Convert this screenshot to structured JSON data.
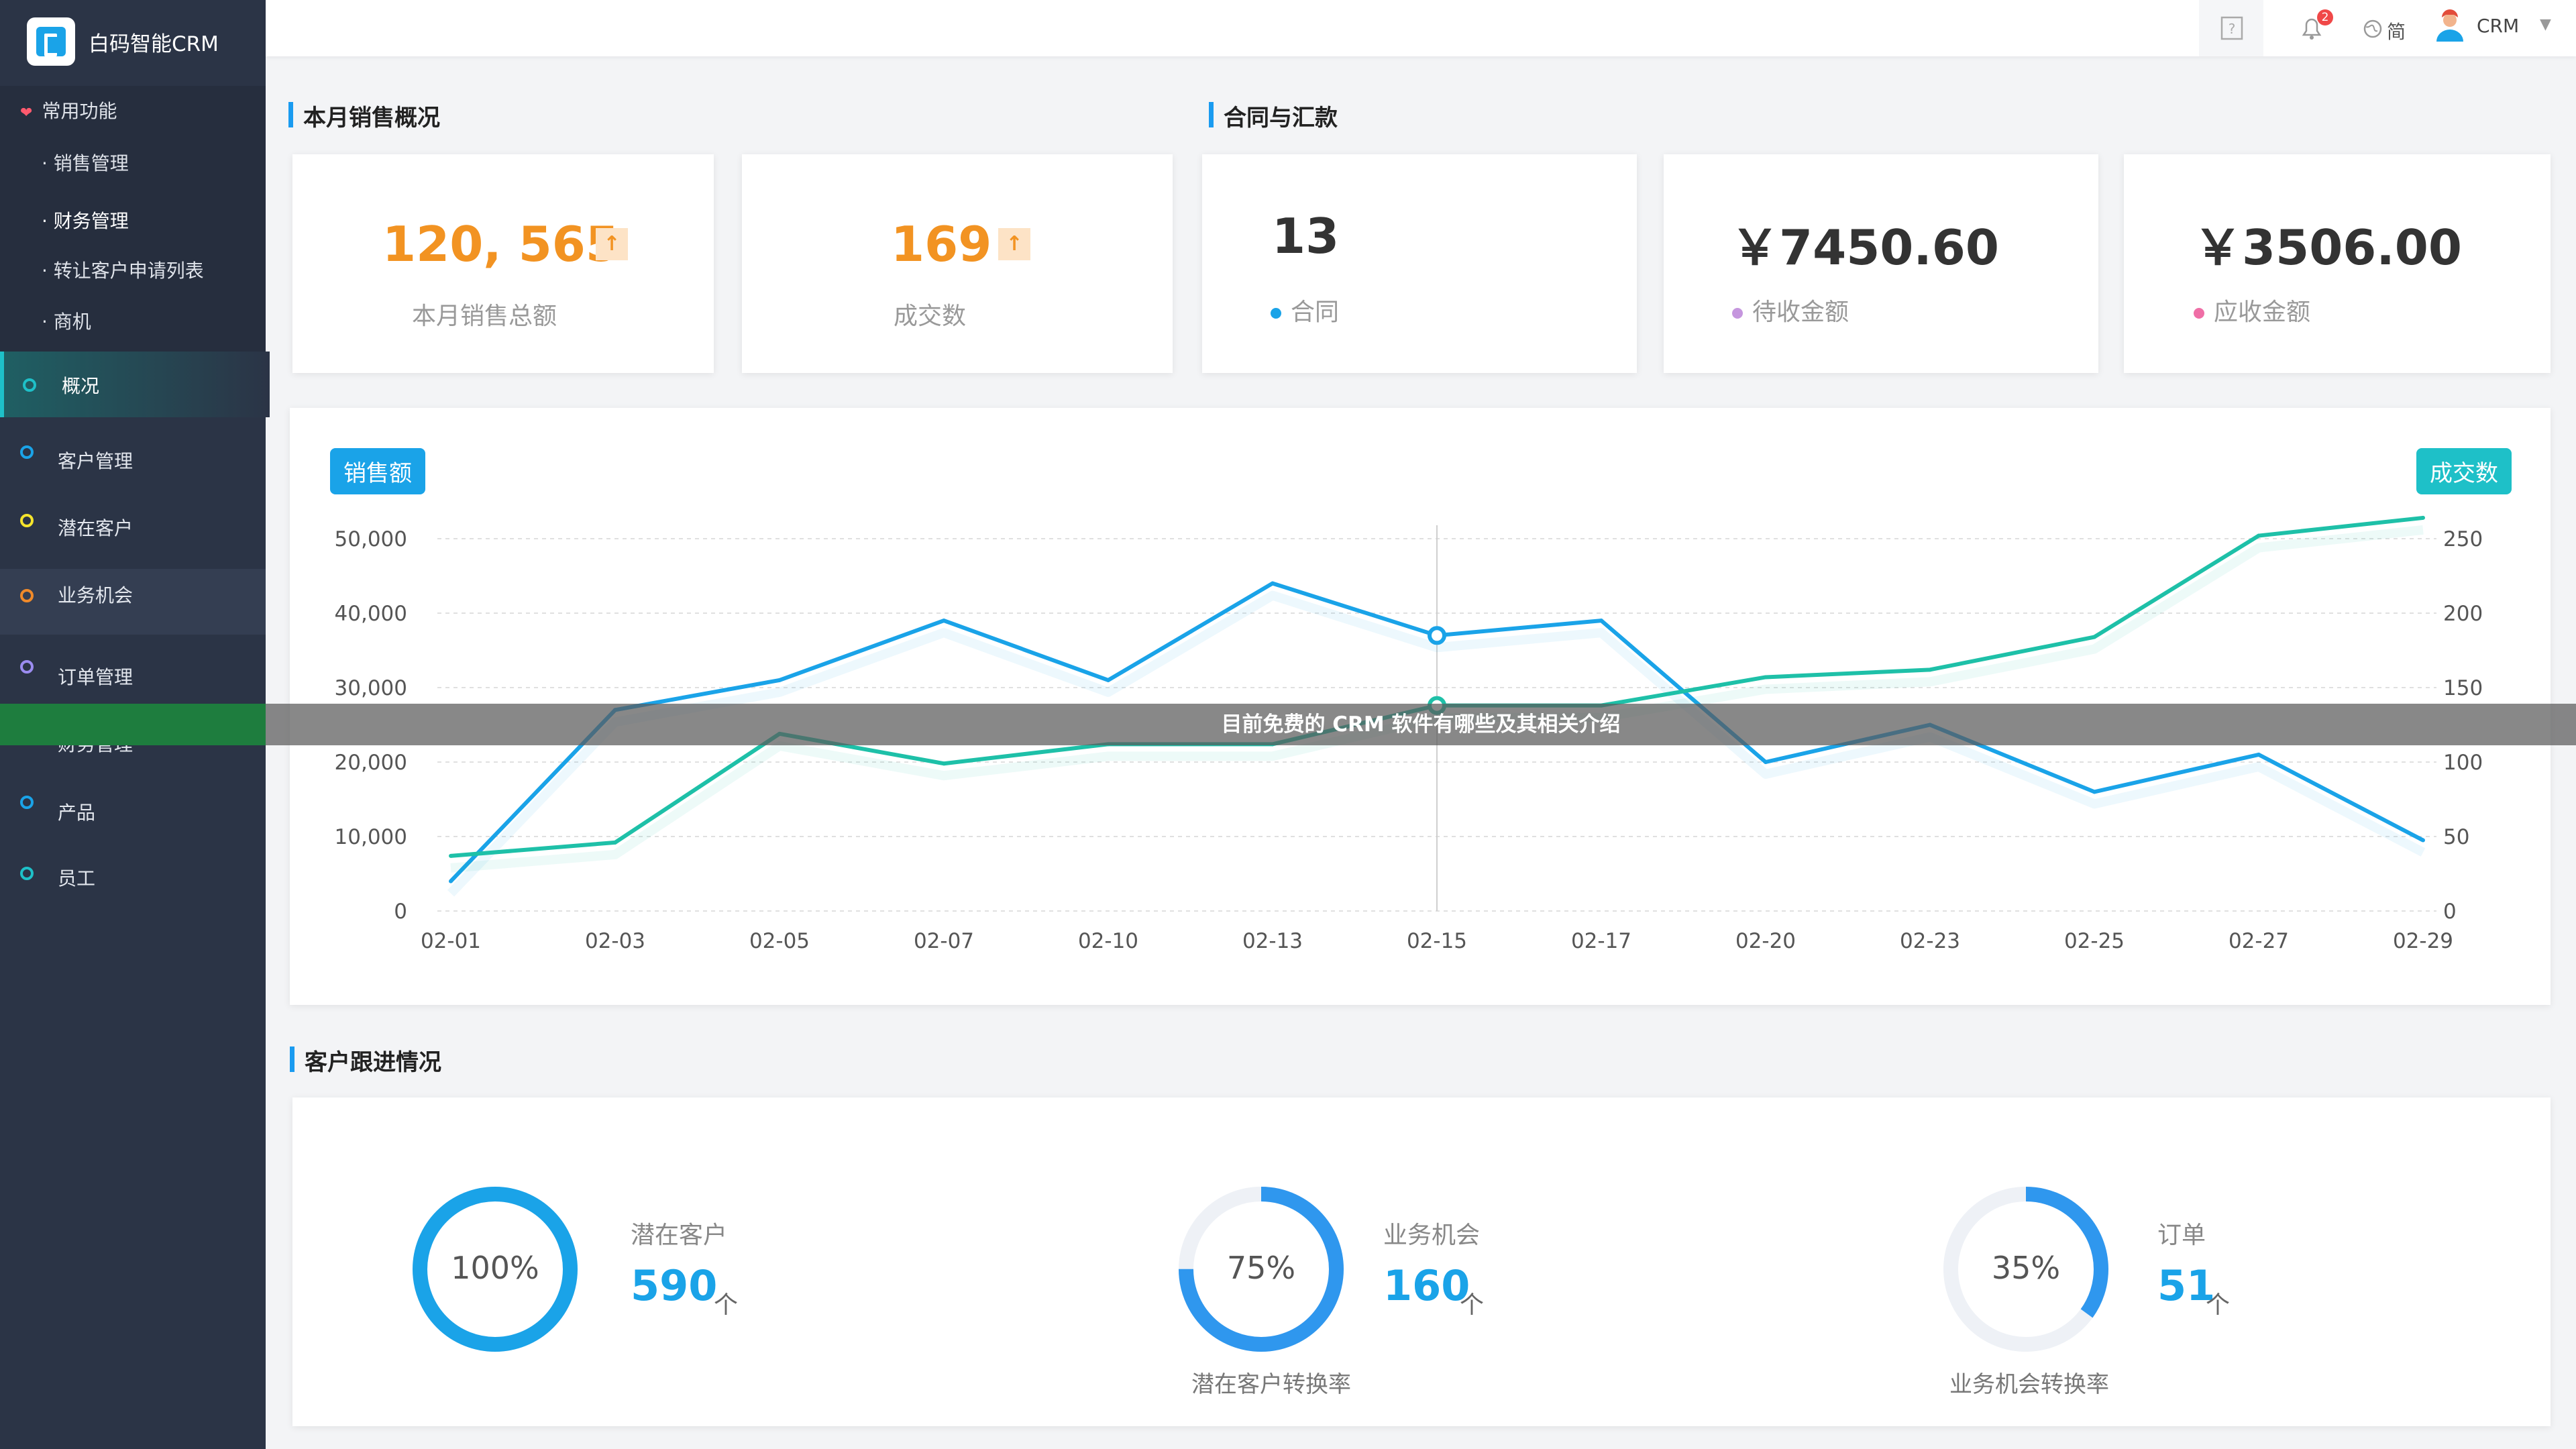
{
  "app": {
    "name": "白码智能CRM"
  },
  "sidebar": {
    "section_title": "常用功能",
    "sub_items": [
      {
        "label": "· 销售管理"
      },
      {
        "label": "· 财务管理"
      },
      {
        "label": "· 转让客户申请列表"
      },
      {
        "label": "· 商机"
      }
    ],
    "nav_items": [
      {
        "label": "概况",
        "color": "#1ec0c8"
      },
      {
        "label": "客户管理",
        "color": "#1aa3e8"
      },
      {
        "label": "潜在客户",
        "color": "#f5e42c"
      },
      {
        "label": "业务机会",
        "color": "#f08a2a"
      },
      {
        "label": "订单管理",
        "color": "#9b8cf0"
      },
      {
        "label": "财务管理",
        "color": "#36c26a"
      },
      {
        "label": "产品",
        "color": "#1aa3e8"
      },
      {
        "label": "员工",
        "color": "#1ec0c8"
      }
    ]
  },
  "topbar": {
    "notification_count": "2",
    "lang": "简",
    "user": "CRM"
  },
  "sections": {
    "sales": "本月销售概况",
    "contracts": "合同与汇款",
    "followup": "客户跟进情况"
  },
  "stats": {
    "total_sales": {
      "value": "120, 565",
      "label": "本月销售总额"
    },
    "deals": {
      "value": "169",
      "label": "成交数"
    },
    "contracts": {
      "value": "13",
      "label": "合同"
    },
    "pending": {
      "value": "￥7450.60",
      "label": "待收金额"
    },
    "receivable": {
      "value": "￥3506.00",
      "label": "应收金额"
    }
  },
  "chart_data": {
    "type": "line",
    "categories": [
      "02-01",
      "02-03",
      "02-05",
      "02-07",
      "02-10",
      "02-13",
      "02-15",
      "02-17",
      "02-20",
      "02-23",
      "02-25",
      "02-27",
      "02-29"
    ],
    "series": [
      {
        "name": "销售额",
        "axis": "left",
        "color": "#1aa3e8",
        "values": [
          4000,
          27000,
          31000,
          39000,
          31000,
          44000,
          37000,
          39000,
          20000,
          25000,
          16000,
          21000,
          9500
        ]
      },
      {
        "name": "成交数",
        "axis": "right",
        "color": "#1ec0a8",
        "values": [
          37,
          46,
          119,
          99,
          112,
          112,
          138,
          138,
          157,
          162,
          184,
          252,
          264
        ]
      }
    ],
    "left_axis": {
      "ticks": [
        "0",
        "10,000",
        "20,000",
        "30,000",
        "40,000",
        "50,000"
      ],
      "ylim": [
        0,
        50000
      ]
    },
    "right_axis": {
      "ticks": [
        "0",
        "50",
        "100",
        "150",
        "200",
        "250"
      ],
      "ylim": [
        0,
        250
      ]
    },
    "legend_left": "销售额",
    "legend_right": "成交数",
    "highlight_category": "02-15",
    "grid": true
  },
  "followup": {
    "items": [
      {
        "percent": "100%",
        "fraction": 1.0,
        "label": "潜在客户",
        "count": "590",
        "unit": "个",
        "caption": ""
      },
      {
        "percent": "75%",
        "fraction": 0.75,
        "label": "业务机会",
        "count": "160",
        "unit": "个",
        "caption": "潜在客户转换率"
      },
      {
        "percent": "35%",
        "fraction": 0.35,
        "label": "订单",
        "count": "51",
        "unit": "个",
        "caption": "业务机会转换率"
      }
    ]
  },
  "banner": "目前免费的 CRM 软件有哪些及其相关介绍"
}
